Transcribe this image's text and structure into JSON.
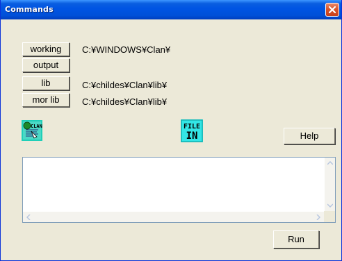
{
  "window": {
    "title": "Commands"
  },
  "buttons": {
    "working": "working",
    "output": "output",
    "lib": "lib",
    "mor_lib": "mor lib",
    "help": "Help",
    "run": "Run"
  },
  "paths": {
    "working": "C:¥WINDOWS¥Clan¥",
    "output": "",
    "lib": "C:¥childes¥Clan¥lib¥",
    "mor_lib": "C:¥childes¥Clan¥lib¥"
  },
  "icons": {
    "clan_label": "CLAN",
    "file_in_line1": "FILE",
    "file_in_line2": "IN"
  },
  "command_text": ""
}
